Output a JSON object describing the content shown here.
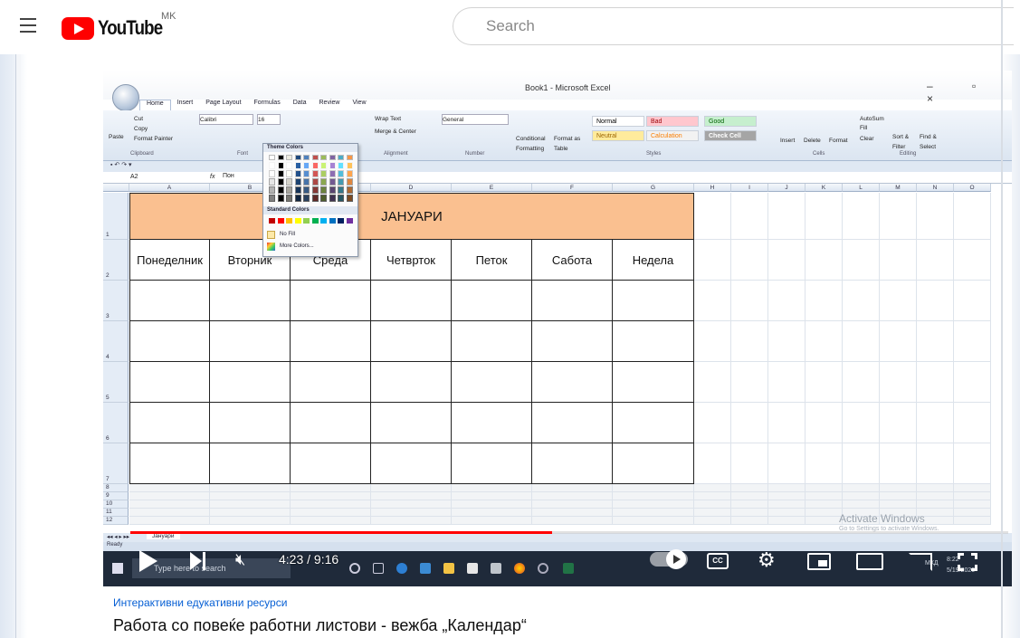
{
  "header": {
    "region": "MK",
    "search_placeholder": "Search"
  },
  "excel": {
    "title": "Book1 - Microsoft Excel",
    "tabs": [
      "Home",
      "Insert",
      "Page Layout",
      "Formulas",
      "Data",
      "Review",
      "View"
    ],
    "clipboard": {
      "cut": "Cut",
      "copy": "Copy",
      "paste": "Paste",
      "format_painter": "Format Painter",
      "caption": "Clipboard"
    },
    "font": {
      "name": "Calibri",
      "size": "16",
      "caption": "Font"
    },
    "alignment": {
      "wrap": "Wrap Text",
      "merge": "Merge & Center",
      "caption": "Alignment"
    },
    "number": {
      "format": "General",
      "caption": "Number"
    },
    "styles": {
      "conditional": "Conditional Formatting",
      "format_as_table": "Format as Table",
      "normal": "Normal",
      "bad": "Bad",
      "good": "Good",
      "neutral": "Neutral",
      "calculation": "Calculation",
      "check_cell": "Check Cell",
      "caption": "Styles"
    },
    "cells": {
      "insert": "Insert",
      "delete": "Delete",
      "format": "Format",
      "caption": "Cells"
    },
    "editing": {
      "autosum": "AutoSum",
      "fill": "Fill",
      "clear": "Clear",
      "sort": "Sort & Filter",
      "find": "Find & Select",
      "caption": "Editing"
    },
    "name_box": "A2",
    "formula_value": "Пон",
    "columns": [
      "A",
      "B",
      "C",
      "D",
      "E",
      "F",
      "G",
      "H",
      "I",
      "J",
      "K",
      "L",
      "M",
      "N",
      "O"
    ],
    "rows": [
      "1",
      "2",
      "3",
      "4",
      "5",
      "6",
      "7",
      "8",
      "9",
      "10",
      "11",
      "12"
    ],
    "month": "ЈАНУАРИ",
    "days": [
      "Понеделник",
      "Вторник",
      "Среда",
      "Четврток",
      "Петок",
      "Сабота",
      "Недела"
    ],
    "palette": {
      "theme_colors_label": "Theme Colors",
      "standard_colors_label": "Standard Colors",
      "no_fill": "No Fill",
      "more_colors": "More Colors...",
      "theme_top": [
        "#ffffff",
        "#000000",
        "#eeece1",
        "#1f497d",
        "#4f81bd",
        "#c0504d",
        "#9bbb59",
        "#8064a2",
        "#4bacc6",
        "#f79646"
      ],
      "standard": [
        "#c00000",
        "#ff0000",
        "#ffc000",
        "#ffff00",
        "#92d050",
        "#00b050",
        "#00b0f0",
        "#0070c0",
        "#002060",
        "#7030a0"
      ]
    },
    "sheet_tab": "Јануари",
    "status": "Ready",
    "activate_title": "Activate Windows",
    "activate_sub": "Go to Settings to activate Windows.",
    "taskbar_search": "Type here to search",
    "clock_time": "8:22",
    "clock_date": "5/19/2020",
    "lang": "МКД"
  },
  "player": {
    "time": "4:23 / 9:16",
    "progress": 0.48,
    "cc": "CC"
  },
  "video": {
    "channel": "Интерактивни едукативни ресурси",
    "title": "Работа со повеќе работни листови - вежба „Календар“"
  }
}
